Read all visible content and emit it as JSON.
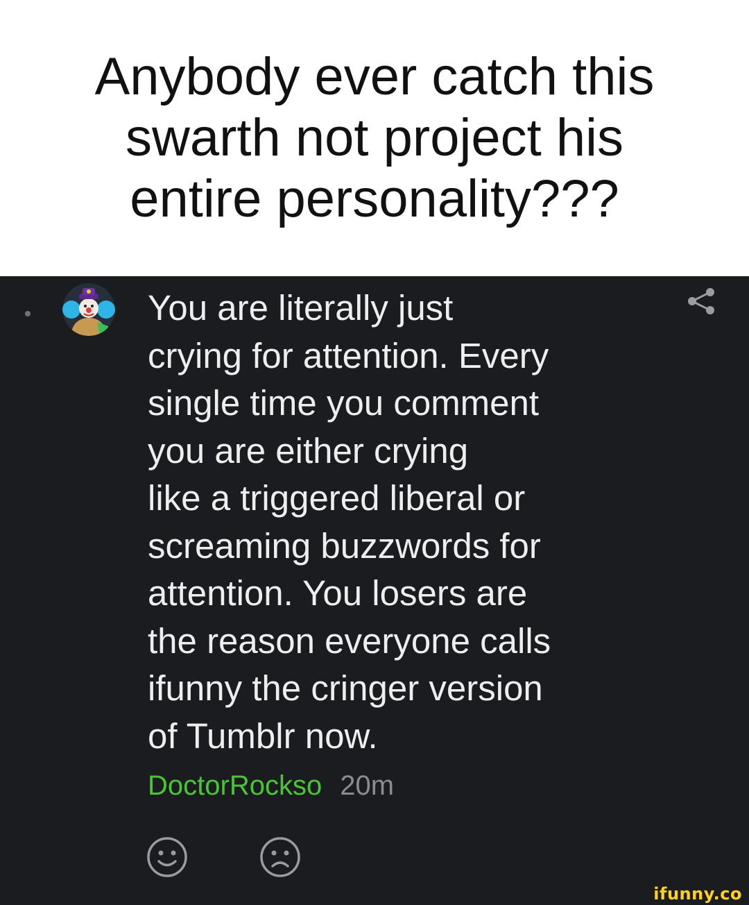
{
  "caption": {
    "text": "Anybody ever catch this\nswarth not project his\nentire personality???"
  },
  "comment": {
    "body": "You are literally just\ncrying for attention. Every\nsingle time you comment\nyou are either crying\nlike a triggered liberal or\nscreaming buzzwords for\nattention. You losers are\nthe reason everyone calls\nifunny the cringer version\nof Tumblr now.",
    "username": "DoctorRockso",
    "timestamp": "20m",
    "avatar_icon": "clown-avatar-icon",
    "share_icon": "share-icon",
    "reactions": [
      "smile-icon",
      "frown-icon"
    ]
  },
  "watermark": {
    "text": "ifunny.co"
  },
  "colors": {
    "panel_background": "#1b1c20",
    "comment_text": "#eeeeee",
    "username": "#49c634",
    "timestamp": "#8a8c91",
    "icon": "#9a9ca2",
    "watermark": "#ffd21e"
  }
}
